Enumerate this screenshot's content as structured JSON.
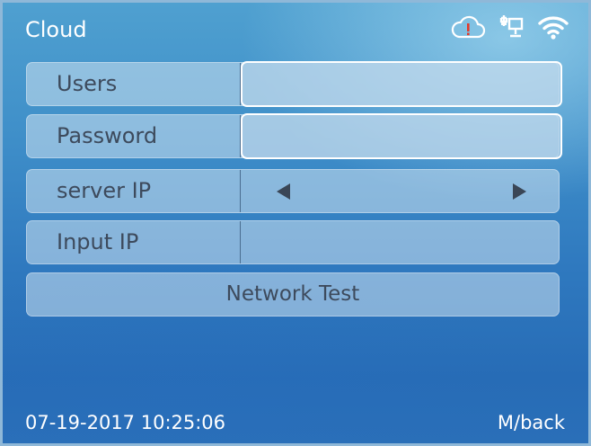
{
  "header": {
    "title": "Cloud",
    "icons": [
      "cloud-alert-icon",
      "ethernet-icon",
      "wifi-icon"
    ],
    "alert_color": "#e23a2a"
  },
  "form": {
    "rows": [
      {
        "label": "Users",
        "value": ""
      },
      {
        "label": "Password",
        "value": ""
      },
      {
        "label": "server IP",
        "value": ""
      },
      {
        "label": "Input IP",
        "value": ""
      }
    ]
  },
  "actions": {
    "network_test_label": "Network Test"
  },
  "footer": {
    "datetime": "07-19-2017 10:25:06",
    "back_label": "M/back"
  }
}
